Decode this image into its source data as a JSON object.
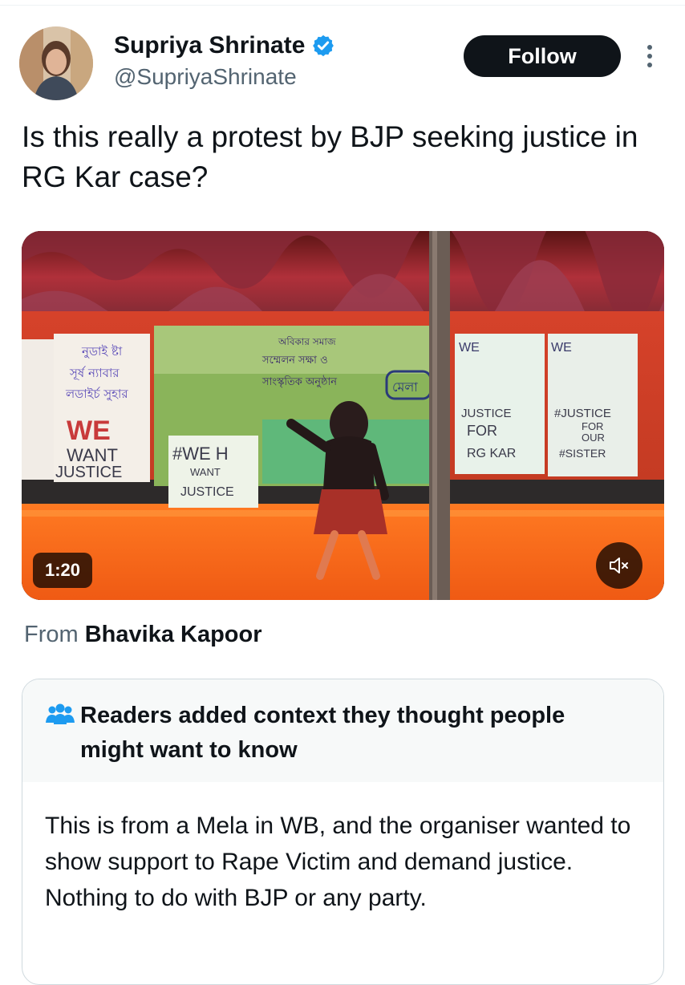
{
  "author": {
    "name": "Supriya Shrinate",
    "handle": "@SupriyaShrinate",
    "verified": true
  },
  "follow_label": "Follow",
  "tweet_text": "Is this really a protest by BJP seeking justice in RG Kar case?",
  "media": {
    "duration": "1:20",
    "signs": {
      "left_we": "WE",
      "left_want": "WANT",
      "left_justice": "JUSTICE",
      "center_weh": "#WE H",
      "center_want": "WANT",
      "center_justice": "JUSTICE",
      "right1_we": "WE",
      "right1_justice": "JUSTICE",
      "right1_for": "FOR",
      "right1_rgkar": "RG KAR",
      "right2_we": "WE",
      "right2_justice": "#JUSTICE",
      "right2_for": "FOR",
      "right2_our": "OUR",
      "right2_sister": "#SISTER"
    }
  },
  "attribution": {
    "prefix": "From",
    "source": "Bhavika Kapoor"
  },
  "community_note": {
    "title": "Readers added context they thought people might want to know",
    "body": "This is from a Mela in WB, and the organiser wanted to show support to Rape Victim and demand justice. Nothing to do with BJP or any party."
  },
  "colors": {
    "text_primary": "#0f1419",
    "text_secondary": "#536471",
    "verified_blue": "#1d9bf0",
    "follow_bg": "#0f1419",
    "note_header_bg": "#f7f9f9"
  },
  "icons": [
    "verified-badge-icon",
    "more-options-icon",
    "muted-speaker-icon",
    "readers-people-icon"
  ]
}
